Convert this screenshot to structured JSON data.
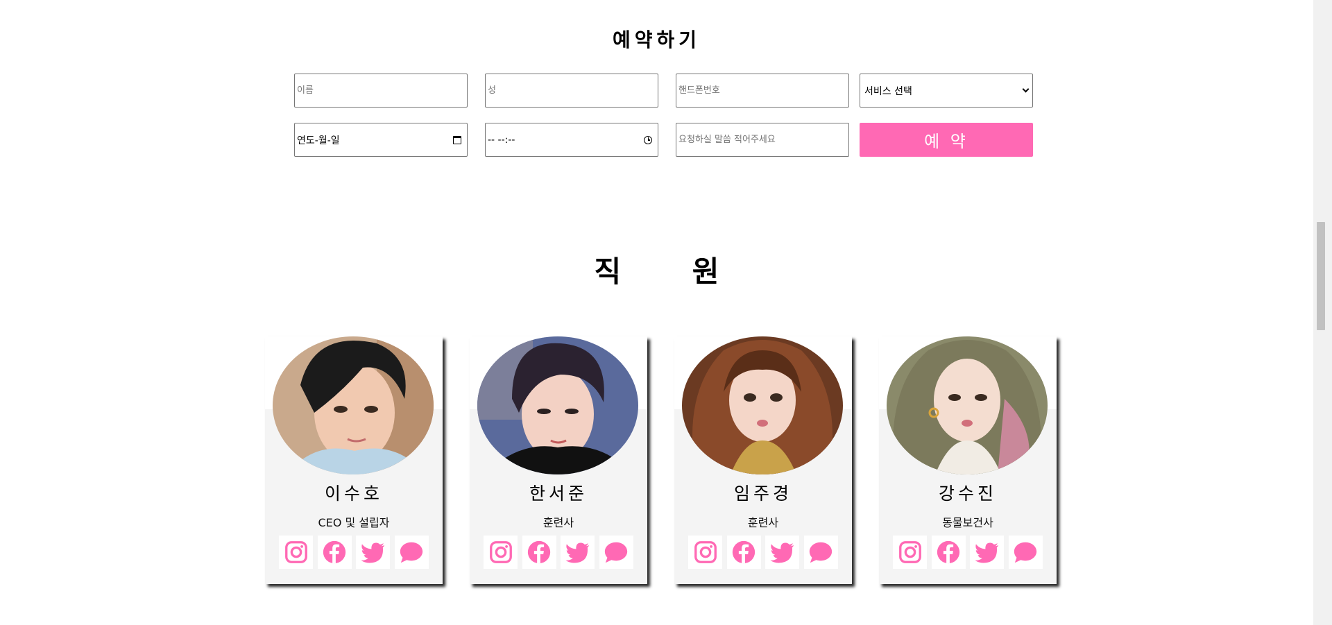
{
  "reservation": {
    "title": "예약하기",
    "first_name_placeholder": "이름",
    "last_name_placeholder": "성",
    "phone_placeholder": "핸드폰번호",
    "service_select": "서비스 선택",
    "date_value": "연도-월-일",
    "time_value": "-- --:--",
    "message_placeholder": "요청하실 말씀 적어주세요",
    "submit_label": "예 약"
  },
  "staff": {
    "title": "직 원",
    "members": [
      {
        "name": "이수호",
        "role": "CEO 및 설립자"
      },
      {
        "name": "한서준",
        "role": "훈련사"
      },
      {
        "name": "임주경",
        "role": "훈련사"
      },
      {
        "name": "강수진",
        "role": "동물보건사"
      }
    ],
    "social_icons": [
      "instagram-icon",
      "facebook-icon",
      "twitter-icon",
      "chat-bubble-icon"
    ]
  },
  "colors": {
    "accent_pink": "#ff69b4",
    "card_bg": "#f4f4f4"
  }
}
